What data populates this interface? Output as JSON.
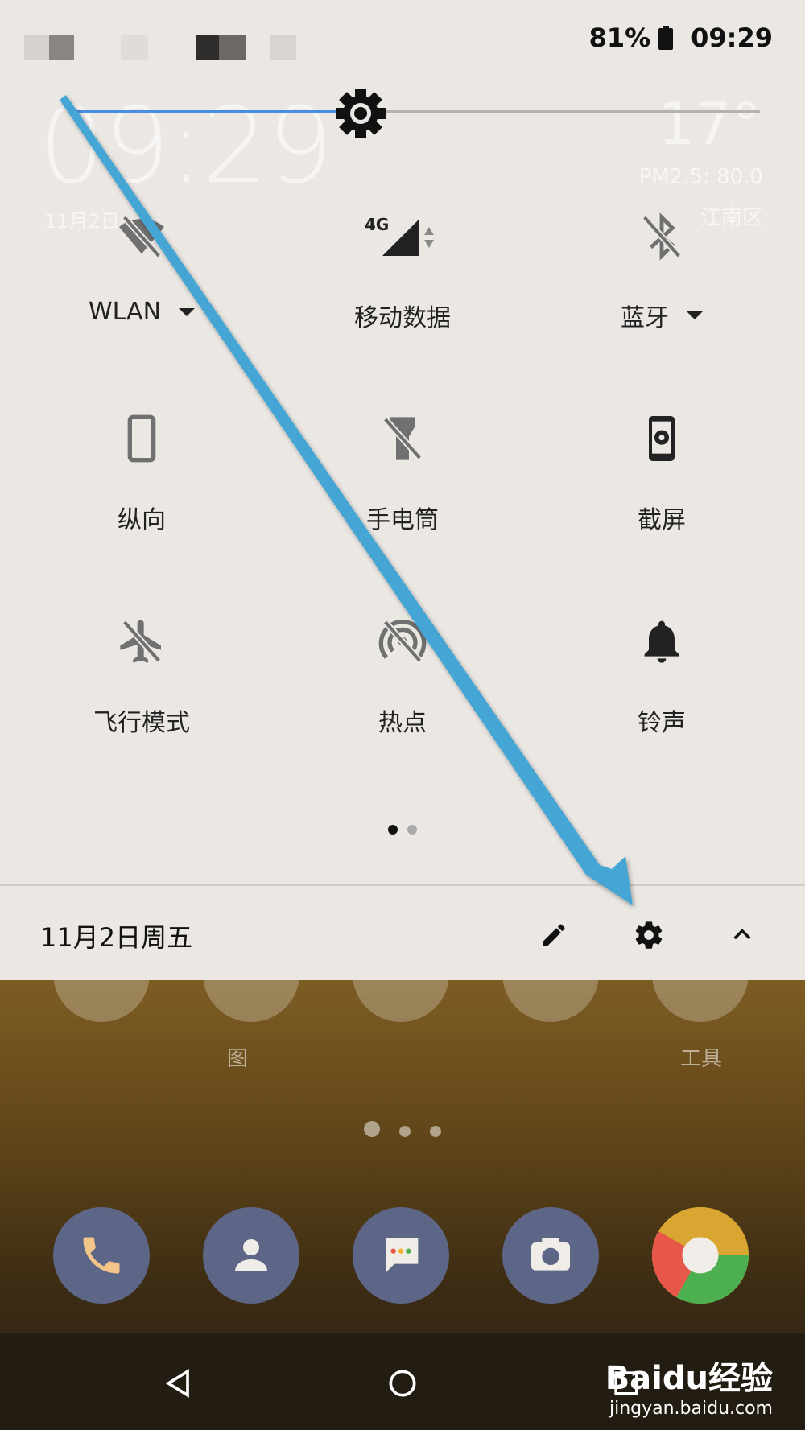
{
  "status_bar": {
    "battery": "81%",
    "time": "09:29"
  },
  "brightness": {
    "level": 0.42
  },
  "lockscreen_ghost": {
    "clock": "09:29",
    "date": "11月2日",
    "temperature": "17°",
    "pm25": "PM2.5: 80.0",
    "location": "江南区"
  },
  "quick_settings": {
    "tiles": [
      {
        "label": "WLAN",
        "icon": "wifi-off-icon",
        "dropdown": true
      },
      {
        "label": "移动数据",
        "icon": "mobile-data-icon",
        "badge": "4G",
        "dropdown": false
      },
      {
        "label": "蓝牙",
        "icon": "bluetooth-off-icon",
        "dropdown": true
      },
      {
        "label": "纵向",
        "icon": "portrait-icon",
        "dropdown": false
      },
      {
        "label": "手电筒",
        "icon": "flashlight-off-icon",
        "dropdown": false
      },
      {
        "label": "截屏",
        "icon": "screenshot-icon",
        "dropdown": false
      },
      {
        "label": "飞行模式",
        "icon": "airplane-off-icon",
        "dropdown": false
      },
      {
        "label": "热点",
        "icon": "hotspot-off-icon",
        "dropdown": false
      },
      {
        "label": "铃声",
        "icon": "bell-icon",
        "dropdown": false
      }
    ],
    "page_count": 2,
    "current_page": 1
  },
  "footer": {
    "date": "11月2日周五",
    "edit_icon": "pencil-icon",
    "settings_icon": "gear-icon",
    "collapse_icon": "chevron-up-icon"
  },
  "home_screen": {
    "app_labels": [
      "图",
      "工具"
    ],
    "dock": [
      "phone-icon",
      "contacts-icon",
      "messages-icon",
      "camera-icon",
      "chrome-icon"
    ]
  },
  "watermark": {
    "brand": "Baidu经验",
    "url": "jingyan.baidu.com"
  },
  "colors": {
    "accent": "#4a8ee0",
    "arrow": "#45a6d6",
    "shade_bg": "#ebe8e4"
  }
}
